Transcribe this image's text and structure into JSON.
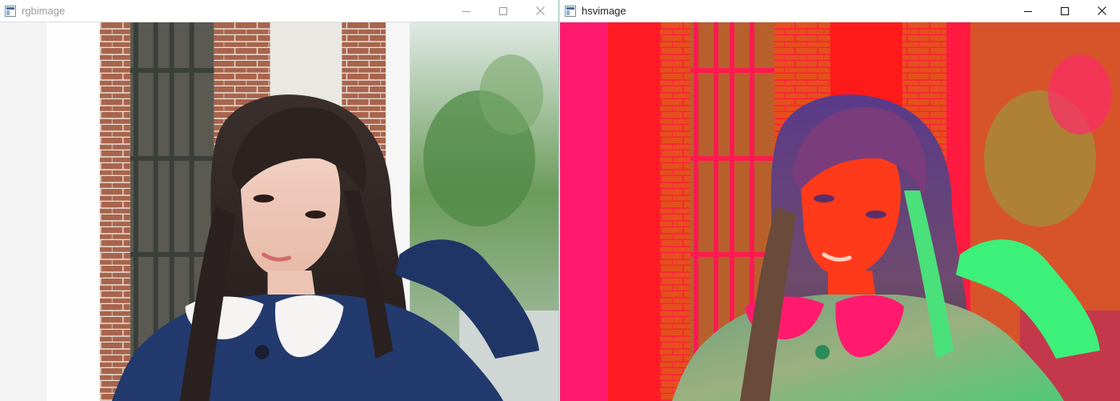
{
  "windows": [
    {
      "title": "rgbimage",
      "active": false,
      "controls": {
        "minimize": "minimize-icon",
        "maximize": "maximize-icon",
        "close": "close-icon"
      },
      "image": "rgb-portrait"
    },
    {
      "title": "hsvimage",
      "active": true,
      "controls": {
        "minimize": "minimize-icon",
        "maximize": "maximize-icon",
        "close": "close-icon"
      },
      "image": "hsv-portrait"
    }
  ],
  "colors": {
    "titlebar_bg": "#ffffff",
    "inactive_title": "#999999",
    "active_title": "#222222",
    "hsv_red": "#ff1a24",
    "hsv_magenta": "#ff1a6e",
    "hsv_green": "#3cf07a"
  }
}
